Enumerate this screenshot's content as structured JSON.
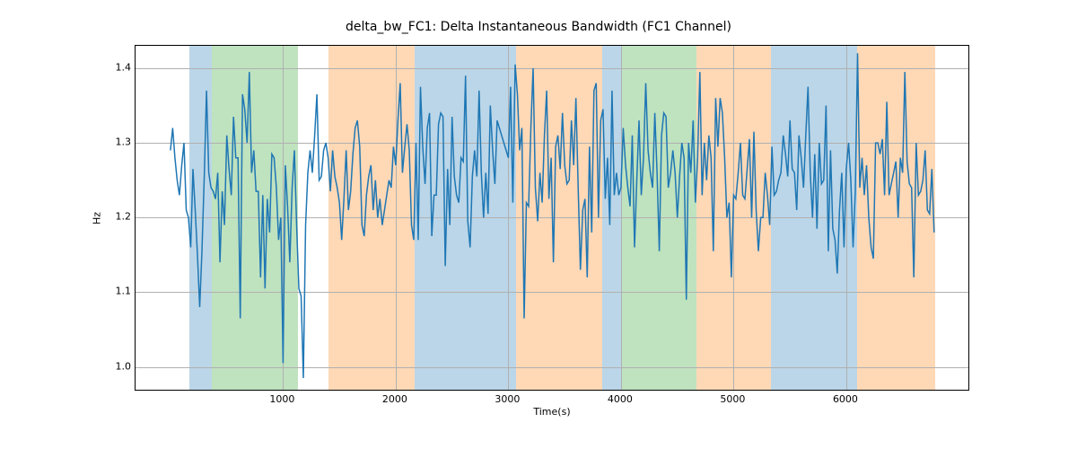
{
  "chart_data": {
    "type": "line",
    "title": "delta_bw_FC1: Delta Instantaneous Bandwidth (FC1 Channel)",
    "xlabel": "Time(s)",
    "ylabel": "Hz",
    "xlim": [
      -310,
      7100
    ],
    "ylim": [
      0.967,
      1.43
    ],
    "xticks": [
      1000,
      2000,
      3000,
      4000,
      5000,
      6000
    ],
    "yticks": [
      1.0,
      1.1,
      1.2,
      1.3,
      1.4
    ],
    "bands": [
      {
        "x0": 167,
        "x1": 367,
        "color": "#1f77b4"
      },
      {
        "x0": 367,
        "x1": 1133,
        "color": "#2ca02c"
      },
      {
        "x0": 1400,
        "x1": 2167,
        "color": "#ff7f0e"
      },
      {
        "x0": 2167,
        "x1": 3067,
        "color": "#1f77b4"
      },
      {
        "x0": 3067,
        "x1": 3833,
        "color": "#ff7f0e"
      },
      {
        "x0": 3833,
        "x1": 4000,
        "color": "#1f77b4"
      },
      {
        "x0": 4000,
        "x1": 4667,
        "color": "#2ca02c"
      },
      {
        "x0": 4667,
        "x1": 5333,
        "color": "#ff7f0e"
      },
      {
        "x0": 5333,
        "x1": 6100,
        "color": "#1f77b4"
      },
      {
        "x0": 6100,
        "x1": 6790,
        "color": "#ff7f0e"
      }
    ],
    "series": [
      {
        "name": "delta_bw_FC1",
        "color": "#1f77b4",
        "x": [
          0,
          20,
          40,
          60,
          80,
          100,
          120,
          140,
          160,
          180,
          200,
          220,
          240,
          260,
          280,
          300,
          320,
          340,
          360,
          380,
          400,
          420,
          440,
          460,
          480,
          500,
          520,
          540,
          560,
          580,
          600,
          620,
          640,
          660,
          680,
          700,
          720,
          740,
          760,
          780,
          800,
          820,
          840,
          860,
          880,
          900,
          920,
          940,
          960,
          980,
          1000,
          1020,
          1040,
          1060,
          1080,
          1100,
          1120,
          1140,
          1160,
          1180,
          1200,
          1220,
          1240,
          1260,
          1280,
          1300,
          1320,
          1340,
          1360,
          1380,
          1400,
          1420,
          1440,
          1460,
          1480,
          1500,
          1520,
          1540,
          1560,
          1580,
          1600,
          1620,
          1640,
          1660,
          1680,
          1700,
          1720,
          1740,
          1760,
          1780,
          1800,
          1820,
          1840,
          1860,
          1880,
          1900,
          1920,
          1940,
          1960,
          1980,
          2000,
          2020,
          2040,
          2060,
          2080,
          2100,
          2120,
          2140,
          2160,
          2180,
          2200,
          2220,
          2240,
          2260,
          2280,
          2300,
          2320,
          2340,
          2360,
          2380,
          2400,
          2420,
          2440,
          2460,
          2480,
          2500,
          2520,
          2540,
          2560,
          2580,
          2600,
          2620,
          2640,
          2660,
          2680,
          2700,
          2720,
          2740,
          2760,
          2780,
          2800,
          2820,
          2840,
          2860,
          2880,
          2900,
          2920,
          2940,
          2960,
          2980,
          3000,
          3020,
          3040,
          3060,
          3080,
          3100,
          3120,
          3140,
          3160,
          3180,
          3200,
          3220,
          3240,
          3260,
          3280,
          3300,
          3320,
          3340,
          3360,
          3380,
          3400,
          3420,
          3440,
          3460,
          3480,
          3500,
          3520,
          3540,
          3560,
          3580,
          3600,
          3620,
          3640,
          3660,
          3680,
          3700,
          3720,
          3740,
          3760,
          3780,
          3800,
          3820,
          3840,
          3860,
          3880,
          3900,
          3920,
          3940,
          3960,
          3980,
          4000,
          4020,
          4040,
          4060,
          4080,
          4100,
          4120,
          4140,
          4160,
          4180,
          4200,
          4220,
          4240,
          4260,
          4280,
          4300,
          4320,
          4340,
          4360,
          4380,
          4400,
          4420,
          4440,
          4460,
          4480,
          4500,
          4520,
          4540,
          4560,
          4580,
          4600,
          4620,
          4640,
          4660,
          4680,
          4700,
          4720,
          4740,
          4760,
          4780,
          4800,
          4820,
          4840,
          4860,
          4880,
          4900,
          4920,
          4940,
          4960,
          4980,
          5000,
          5020,
          5040,
          5060,
          5080,
          5100,
          5120,
          5140,
          5160,
          5180,
          5200,
          5220,
          5240,
          5260,
          5280,
          5300,
          5320,
          5340,
          5360,
          5380,
          5400,
          5420,
          5440,
          5460,
          5480,
          5500,
          5520,
          5540,
          5560,
          5580,
          5600,
          5620,
          5640,
          5660,
          5680,
          5700,
          5720,
          5740,
          5760,
          5780,
          5800,
          5820,
          5840,
          5860,
          5880,
          5900,
          5920,
          5940,
          5960,
          5980,
          6000,
          6020,
          6040,
          6060,
          6080,
          6100,
          6120,
          6140,
          6160,
          6180,
          6200,
          6220,
          6240,
          6260,
          6280,
          6300,
          6320,
          6340,
          6360,
          6380,
          6400,
          6420,
          6440,
          6460,
          6480,
          6500,
          6520,
          6540,
          6560,
          6580,
          6600,
          6620,
          6640,
          6660,
          6680,
          6700,
          6720,
          6740,
          6760,
          6780
        ],
        "y": [
          1.29,
          1.32,
          1.28,
          1.25,
          1.23,
          1.27,
          1.3,
          1.21,
          1.2,
          1.16,
          1.265,
          1.21,
          1.15,
          1.08,
          1.155,
          1.255,
          1.37,
          1.26,
          1.24,
          1.235,
          1.225,
          1.26,
          1.14,
          1.235,
          1.19,
          1.31,
          1.265,
          1.23,
          1.335,
          1.28,
          1.28,
          1.065,
          1.365,
          1.345,
          1.3,
          1.395,
          1.26,
          1.29,
          1.235,
          1.235,
          1.12,
          1.23,
          1.105,
          1.225,
          1.18,
          1.285,
          1.28,
          1.24,
          1.17,
          1.2,
          1.005,
          1.27,
          1.215,
          1.14,
          1.24,
          1.29,
          1.19,
          1.105,
          1.095,
          0.985,
          1.19,
          1.26,
          1.29,
          1.26,
          1.31,
          1.365,
          1.25,
          1.255,
          1.29,
          1.3,
          1.28,
          1.235,
          1.29,
          1.255,
          1.24,
          1.22,
          1.17,
          1.225,
          1.29,
          1.21,
          1.235,
          1.285,
          1.32,
          1.33,
          1.295,
          1.19,
          1.175,
          1.23,
          1.255,
          1.27,
          1.21,
          1.25,
          1.2,
          1.225,
          1.19,
          1.21,
          1.23,
          1.25,
          1.24,
          1.295,
          1.27,
          1.33,
          1.38,
          1.26,
          1.295,
          1.325,
          1.29,
          1.19,
          1.17,
          1.3,
          1.17,
          1.375,
          1.295,
          1.245,
          1.32,
          1.34,
          1.175,
          1.23,
          1.23,
          1.325,
          1.34,
          1.335,
          1.135,
          1.265,
          1.19,
          1.335,
          1.255,
          1.23,
          1.22,
          1.28,
          1.275,
          1.39,
          1.195,
          1.16,
          1.255,
          1.29,
          1.255,
          1.37,
          1.26,
          1.2,
          1.26,
          1.205,
          1.35,
          1.29,
          1.245,
          1.33,
          1.32,
          1.31,
          1.3,
          1.29,
          1.28,
          1.375,
          1.22,
          1.405,
          1.365,
          1.29,
          1.32,
          1.065,
          1.22,
          1.215,
          1.32,
          1.4,
          1.24,
          1.195,
          1.26,
          1.22,
          1.31,
          1.37,
          1.225,
          1.28,
          1.14,
          1.295,
          1.31,
          1.265,
          1.34,
          1.27,
          1.245,
          1.25,
          1.33,
          1.27,
          1.36,
          1.24,
          1.13,
          1.21,
          1.225,
          1.12,
          1.295,
          1.18,
          1.37,
          1.38,
          1.2,
          1.33,
          1.345,
          1.225,
          1.28,
          1.19,
          1.37,
          1.23,
          1.26,
          1.23,
          1.24,
          1.32,
          1.27,
          1.24,
          1.215,
          1.31,
          1.16,
          1.25,
          1.33,
          1.23,
          1.28,
          1.38,
          1.29,
          1.26,
          1.24,
          1.34,
          1.26,
          1.155,
          1.31,
          1.34,
          1.335,
          1.24,
          1.26,
          1.29,
          1.26,
          1.2,
          1.255,
          1.3,
          1.28,
          1.09,
          1.3,
          1.26,
          1.33,
          1.22,
          1.28,
          1.395,
          1.23,
          1.3,
          1.25,
          1.31,
          1.28,
          1.155,
          1.36,
          1.295,
          1.36,
          1.34,
          1.28,
          1.2,
          1.22,
          1.12,
          1.23,
          1.225,
          1.26,
          1.3,
          1.23,
          1.225,
          1.265,
          1.305,
          1.2,
          1.315,
          1.21,
          1.155,
          1.2,
          1.2,
          1.26,
          1.23,
          1.19,
          1.295,
          1.23,
          1.235,
          1.25,
          1.26,
          1.31,
          1.285,
          1.255,
          1.33,
          1.265,
          1.26,
          1.21,
          1.31,
          1.28,
          1.24,
          1.31,
          1.375,
          1.26,
          1.2,
          1.285,
          1.185,
          1.3,
          1.245,
          1.25,
          1.35,
          1.155,
          1.29,
          1.185,
          1.17,
          1.125,
          1.21,
          1.26,
          1.16,
          1.265,
          1.3,
          1.25,
          1.16,
          1.235,
          1.42,
          1.24,
          1.28,
          1.23,
          1.27,
          1.2,
          1.16,
          1.145,
          1.3,
          1.3,
          1.285,
          1.305,
          1.23,
          1.355,
          1.23,
          1.245,
          1.26,
          1.275,
          1.2,
          1.28,
          1.26,
          1.395,
          1.275,
          1.245,
          1.24,
          1.12,
          1.3,
          1.23,
          1.235,
          1.25,
          1.29,
          1.21,
          1.205,
          1.265,
          1.18
        ]
      }
    ]
  }
}
